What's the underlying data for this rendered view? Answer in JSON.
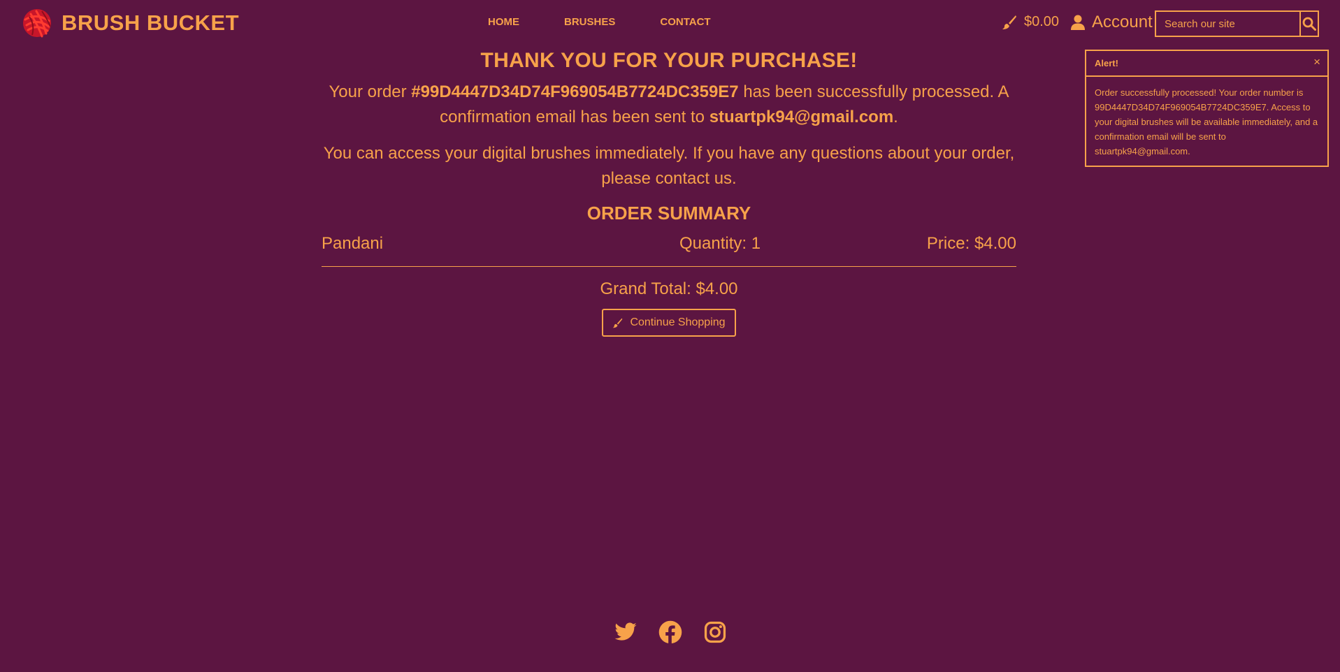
{
  "brand": {
    "name": "BRUSH BUCKET",
    "logo_icon": "brush-splatter-logo-icon"
  },
  "nav": {
    "links": [
      "HOME",
      "BRUSHES",
      "CONTACT"
    ]
  },
  "header": {
    "cart_total": "$0.00",
    "cart_icon": "paintbrush-icon",
    "account_label": "Account",
    "account_icon": "user-icon",
    "search_placeholder": "Search our site",
    "search_icon": "magnifier-icon"
  },
  "main": {
    "title": "THANK YOU FOR YOUR PURCHASE!",
    "order_prefix": "Your order ",
    "order_number": "#99D4447D34D74F969054B7724DC359E7",
    "order_mid": " has been successfully processed. A confirmation email has been sent to ",
    "email": "stuartpk94@gmail.com",
    "order_suffix": ".",
    "access_text": "You can access your digital brushes immediately. If you have any questions about your order, please contact us.",
    "summary_title": "ORDER SUMMARY",
    "items": [
      {
        "name": "Pandani",
        "quantity": "Quantity: 1",
        "price": "Price: $4.00"
      }
    ],
    "grand_total": "Grand Total: $4.00",
    "continue_label": "Continue Shopping"
  },
  "alert": {
    "title": "Alert!",
    "close": "×",
    "message": "Order successfully processed! Your order number is 99D4447D34D74F969054B7724DC359E7. Access to your digital brushes will be available immediately, and a confirmation email will be sent to stuartpk94@gmail.com."
  },
  "footer": {
    "social_icons": [
      "twitter-icon",
      "facebook-icon",
      "instagram-icon"
    ]
  },
  "colors": {
    "background": "#5c1541",
    "accent": "#f7a24a",
    "logo_red": "#e0262a"
  }
}
